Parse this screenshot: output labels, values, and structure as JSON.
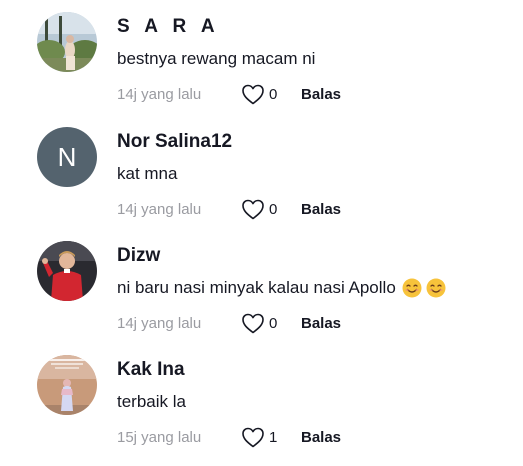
{
  "comments": [
    {
      "avatar": "photo-avatar",
      "username": "S A R A",
      "text": "bestnya rewang macam ni",
      "time": "14j yang lalu",
      "likes": "0",
      "reply_label": "Balas"
    },
    {
      "avatar": "N",
      "username": "Nor Salina12",
      "text": "kat mna",
      "time": "14j yang lalu",
      "likes": "0",
      "reply_label": "Balas"
    },
    {
      "avatar": "photo-avatar",
      "username": "Dizw",
      "text": "ni baru nasi minyak kalau nasi Apollo",
      "emojis": [
        "smiling-face-emoji",
        "smiling-face-emoji"
      ],
      "time": "14j yang lalu",
      "likes": "0",
      "reply_label": "Balas"
    },
    {
      "avatar": "photo-avatar",
      "username": "Kak Ina",
      "text": "terbaik la",
      "time": "15j yang lalu",
      "likes": "1",
      "reply_label": "Balas"
    }
  ],
  "colors": {
    "text": "#161823",
    "muted": "#9a9ba1",
    "letter_avatar_bg": "#54636e"
  },
  "icons": {
    "like": "heart-outline-icon"
  }
}
